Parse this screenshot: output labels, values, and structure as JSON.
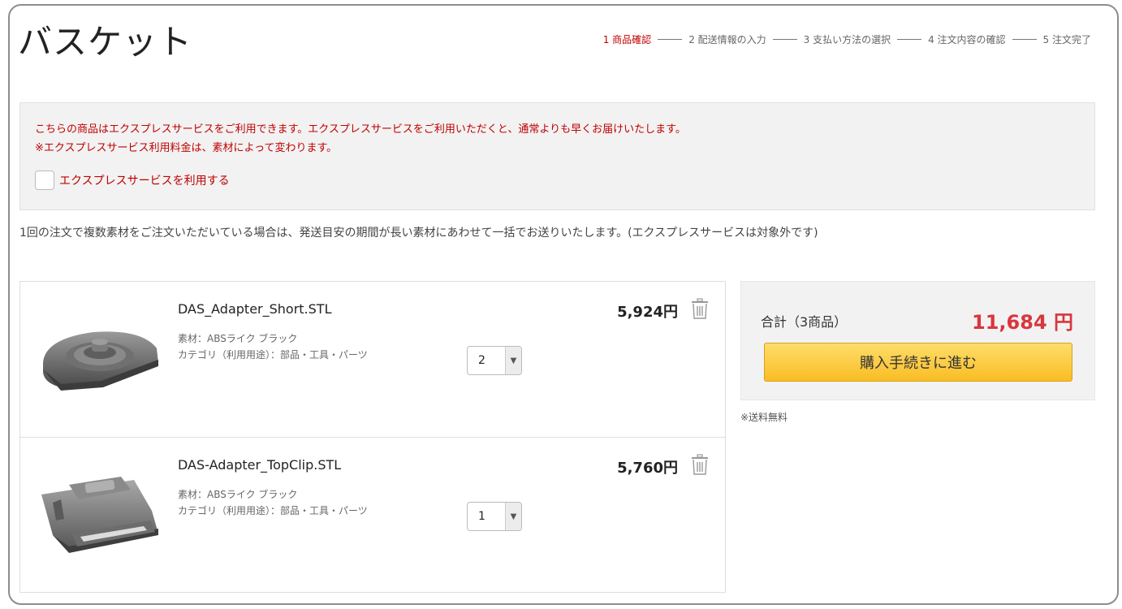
{
  "page": {
    "title": "バスケット"
  },
  "steps": [
    {
      "label": "1 商品確認",
      "active": true
    },
    {
      "label": "2 配送情報の入力",
      "active": false
    },
    {
      "label": "3 支払い方法の選択",
      "active": false
    },
    {
      "label": "4 注文内容の確認",
      "active": false
    },
    {
      "label": "5 注文完了",
      "active": false
    }
  ],
  "express": {
    "message_line1": "こちらの商品はエクスプレスサービスをご利用できます。エクスプレスサービスをご利用いただくと、通常よりも早くお届けいたします。",
    "message_line2": "※エクスプレスサービス利用料金は、素材によって変わります。",
    "checkbox_label": "エクスプレスサービスを利用する",
    "checked": false
  },
  "multi_material_note": "1回の注文で複数素材をご注文いただいている場合は、発送目安の期間が長い素材にあわせて一括でお送りいたします。(エクスプレスサービスは対象外です)",
  "cart_items": [
    {
      "name": "DAS_Adapter_Short.STL",
      "material": "素材：ABSライク ブラック",
      "category": "カテゴリ（利用用途）：部品・工具・パーツ",
      "quantity": "2",
      "price": "5,924円"
    },
    {
      "name": "DAS-Adapter_TopClip.STL",
      "material": "素材：ABSライク ブラック",
      "category": "カテゴリ（利用用途）：部品・工具・パーツ",
      "quantity": "1",
      "price": "5,760円"
    }
  ],
  "summary": {
    "label": "合計（3商品）",
    "total": "11,684 円",
    "checkout_label": "購入手続きに進む"
  },
  "shipping_note": "※送料無料",
  "colors": {
    "accent_red": "#c00000",
    "total_red": "#d9363e",
    "button_yellow": "#f9bd24"
  }
}
